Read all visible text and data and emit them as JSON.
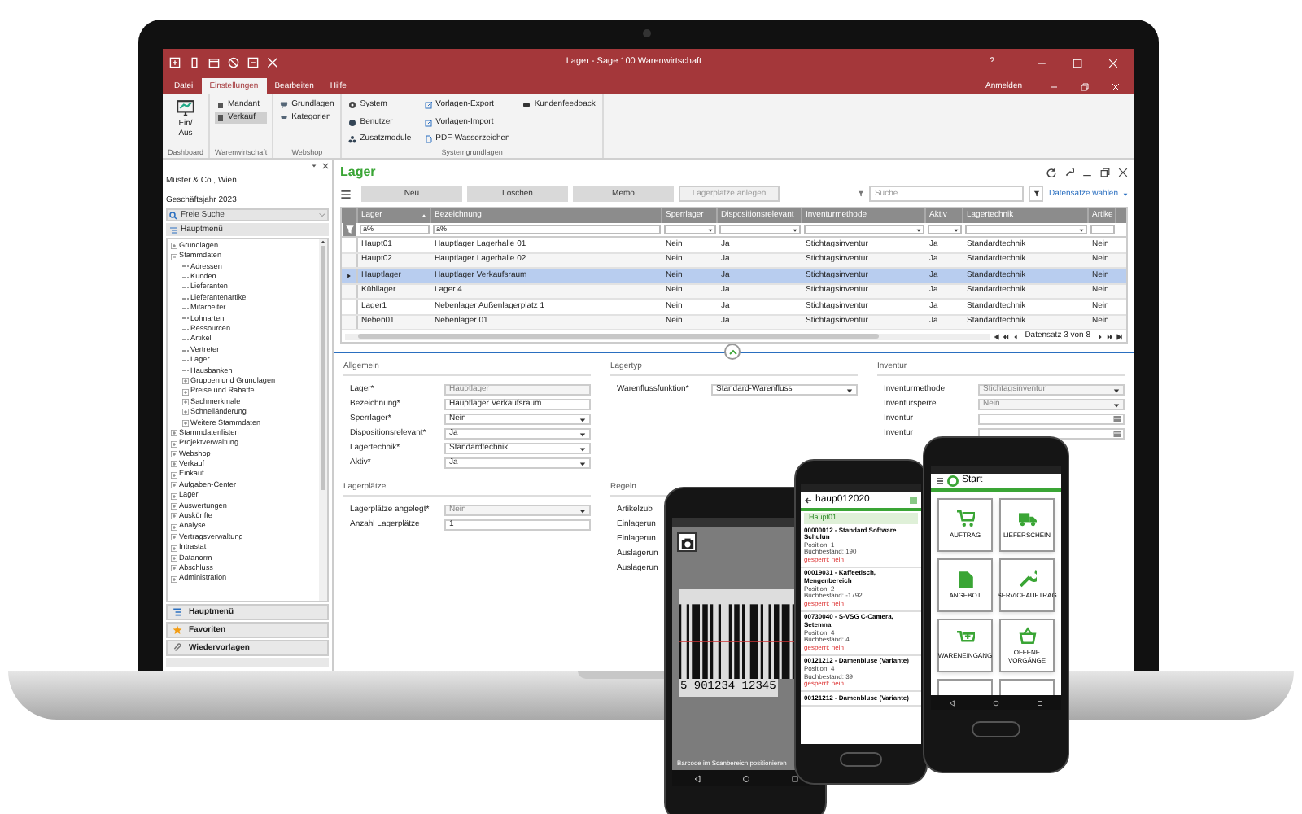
{
  "window": {
    "title": "Lager - Sage 100 Warenwirtschaft",
    "help": "?"
  },
  "menu_tabs": [
    {
      "label": "Datei",
      "selected": false
    },
    {
      "label": "Einstellungen",
      "selected": true
    },
    {
      "label": "Bearbeiten",
      "selected": false
    },
    {
      "label": "Hilfe",
      "selected": false
    }
  ],
  "sign_in": "Anmelden",
  "ribbon_groups": [
    {
      "label": "Dashboard",
      "items": [
        {
          "label": "Ein/ Aus",
          "kind": "large",
          "selected": false
        }
      ]
    },
    {
      "label": "Warenwirtschaft",
      "items": [
        {
          "label": "Mandant",
          "kind": "small",
          "selected": false
        },
        {
          "label": "Verkauf",
          "kind": "small",
          "selected": true
        }
      ]
    },
    {
      "label": "Webshop",
      "items": [
        {
          "label": "Grundlagen",
          "kind": "small",
          "selected": false
        },
        {
          "label": "Kategorien",
          "kind": "small",
          "selected": false
        }
      ]
    },
    {
      "label": "Systemgrundlagen",
      "items": [
        {
          "label": "System",
          "kind": "small",
          "selected": false
        },
        {
          "label": "Benutzer",
          "kind": "small",
          "selected": false
        },
        {
          "label": "Zusatzmodule",
          "kind": "small",
          "selected": false
        },
        {
          "label": "Vorlagen-Export",
          "kind": "small",
          "selected": false
        },
        {
          "label": "Vorlagen-Import",
          "kind": "small",
          "selected": false
        },
        {
          "label": "PDF-Wasserzeichen",
          "kind": "small",
          "selected": false
        },
        {
          "label": "Kundenfeedback",
          "kind": "small",
          "selected": false
        }
      ]
    }
  ],
  "sidebar": {
    "company": "Muster & Co., Wien",
    "fiscal_year": "Geschäftsjahr 2023",
    "search": {
      "placeholder": "Freie Suche"
    },
    "section": "Hauptmenü",
    "tree": [
      {
        "label": "Grundlagen",
        "expanded": false
      },
      {
        "label": "Stammdaten",
        "expanded": true,
        "children": [
          {
            "label": "Adressen"
          },
          {
            "label": "Kunden"
          },
          {
            "label": "Lieferanten"
          },
          {
            "label": "Lieferantenartikel"
          },
          {
            "label": "Mitarbeiter"
          },
          {
            "label": "Lohnarten"
          },
          {
            "label": "Ressourcen"
          },
          {
            "label": "Artikel"
          },
          {
            "label": "Vertreter"
          },
          {
            "label": "Lager"
          },
          {
            "label": "Hausbanken"
          },
          {
            "label": "Gruppen und Grundlagen",
            "expanded": false
          },
          {
            "label": "Preise und Rabatte",
            "expanded": false
          },
          {
            "label": "Sachmerkmale",
            "expanded": false
          },
          {
            "label": "Schnelländerung",
            "expanded": false
          },
          {
            "label": "Weitere Stammdaten",
            "expanded": false
          }
        ]
      },
      {
        "label": "Stammdatenlisten",
        "expanded": false
      },
      {
        "label": "Projektverwaltung",
        "expanded": false
      },
      {
        "label": "Webshop",
        "expanded": false
      },
      {
        "label": "Verkauf",
        "expanded": false
      },
      {
        "label": "Einkauf",
        "expanded": false
      },
      {
        "label": "Aufgaben-Center",
        "expanded": false
      },
      {
        "label": "Lager",
        "expanded": false
      },
      {
        "label": "Auswertungen",
        "expanded": false
      },
      {
        "label": "Auskünfte",
        "expanded": false
      },
      {
        "label": "Analyse",
        "expanded": false
      },
      {
        "label": "Vertragsverwaltung",
        "expanded": false
      },
      {
        "label": "Intrastat",
        "expanded": false
      },
      {
        "label": "Datanorm",
        "expanded": false
      },
      {
        "label": "Abschluss",
        "expanded": false
      },
      {
        "label": "Administration",
        "expanded": false
      }
    ],
    "nav": [
      {
        "label": "Hauptmenü"
      },
      {
        "label": "Favoriten"
      },
      {
        "label": "Wiedervorlagen"
      }
    ]
  },
  "main": {
    "title": "Lager",
    "toolbar": [
      {
        "label": "Neu",
        "disabled": false
      },
      {
        "label": "Löschen",
        "disabled": false
      },
      {
        "label": "Memo",
        "disabled": false
      },
      {
        "label": "Lagerplätze anlegen",
        "disabled": true
      }
    ],
    "search": {
      "placeholder": "Suche"
    },
    "records_link": "Datensätze wählen",
    "table": {
      "columns": [
        {
          "label": "Lager",
          "filter": "a%",
          "kind": "text"
        },
        {
          "label": "Bezeichnung",
          "filter": "a%",
          "kind": "text"
        },
        {
          "label": "Sperrlager",
          "kind": "select"
        },
        {
          "label": "Dispositionsrelevant",
          "kind": "select"
        },
        {
          "label": "Inventurmethode",
          "kind": "select"
        },
        {
          "label": "Aktiv",
          "kind": "select"
        },
        {
          "label": "Lagertechnik",
          "kind": "select"
        },
        {
          "label": "Artike",
          "kind": "text"
        }
      ],
      "rows": [
        {
          "cells": [
            "Haupt01",
            "Hauptlager Lagerhalle 01",
            "Nein",
            "Ja",
            "Stichtagsinventur",
            "Ja",
            "Standardtechnik",
            "Nein"
          ],
          "selected": false
        },
        {
          "cells": [
            "Haupt02",
            "Hauptlager Lagerhalle 02",
            "Nein",
            "Ja",
            "Stichtagsinventur",
            "Ja",
            "Standardtechnik",
            "Nein"
          ],
          "selected": false
        },
        {
          "cells": [
            "Hauptlager",
            "Hauptlager Verkaufsraum",
            "Nein",
            "Ja",
            "Stichtagsinventur",
            "Ja",
            "Standardtechnik",
            "Nein"
          ],
          "selected": true
        },
        {
          "cells": [
            "Kühllager",
            "Lager 4",
            "Nein",
            "Ja",
            "Stichtagsinventur",
            "Ja",
            "Standardtechnik",
            "Nein"
          ],
          "selected": false
        },
        {
          "cells": [
            "Lager1",
            "Nebenlager Außenlagerplatz 1",
            "Nein",
            "Ja",
            "Stichtagsinventur",
            "Ja",
            "Standardtechnik",
            "Nein"
          ],
          "selected": false
        },
        {
          "cells": [
            "Neben01",
            "Nebenlager 01",
            "Nein",
            "Ja",
            "Stichtagsinventur",
            "Ja",
            "Standardtechnik",
            "Nein"
          ],
          "selected": false
        }
      ],
      "pager": "Datensatz 3 von 8"
    },
    "form": [
      {
        "title": "Allgemein",
        "fields": [
          {
            "label": "Lager*",
            "value": "Hauptlager",
            "kind": "text",
            "disabled": true
          },
          {
            "label": "Bezeichnung*",
            "value": "Hauptlager Verkaufsraum",
            "kind": "text",
            "disabled": false
          },
          {
            "label": "Sperrlager*",
            "value": "Nein",
            "kind": "select",
            "disabled": false
          },
          {
            "label": "Dispositionsrelevant*",
            "value": "Ja",
            "kind": "select",
            "disabled": false
          },
          {
            "label": "Lagertechnik*",
            "value": "Standardtechnik",
            "kind": "select",
            "disabled": false
          },
          {
            "label": "Aktiv*",
            "value": "Ja",
            "kind": "select",
            "disabled": false
          }
        ]
      },
      {
        "title": "Lagertyp",
        "fields": [
          {
            "label": "Warenflussfunktion*",
            "value": "Standard-Warenfluss",
            "kind": "select",
            "disabled": false
          }
        ]
      },
      {
        "title": "Inventur",
        "fields": [
          {
            "label": "Inventurmethode",
            "value": "Stichtagsinventur",
            "kind": "select",
            "disabled": true
          },
          {
            "label": "Inventursperre",
            "value": "Nein",
            "kind": "select",
            "disabled": true
          },
          {
            "label": "Inventur",
            "kind": "date",
            "disabled": false
          },
          {
            "label": "Inventur",
            "kind": "date",
            "disabled": false
          }
        ]
      },
      {
        "title": "Lagerplätze",
        "fields": [
          {
            "label": "Lagerplätze angelegt*",
            "value": "Nein",
            "kind": "select",
            "disabled": true
          },
          {
            "label": "Anzahl Lagerplätze",
            "value": "1",
            "kind": "text",
            "disabled": false
          }
        ]
      },
      {
        "title": "Regeln",
        "fields": [
          {
            "label": "Artikelzub",
            "kind": "label"
          },
          {
            "label": "Einlagerun",
            "kind": "label"
          },
          {
            "label": "Einlagerun",
            "kind": "label"
          },
          {
            "label": "Auslagerun",
            "kind": "label"
          },
          {
            "label": "Auslagerun",
            "kind": "label"
          }
        ]
      }
    ]
  },
  "phones": {
    "scanner": {
      "barcode_digits": "5 901234 12345",
      "hint": "Barcode im Scanbereich positionieren"
    },
    "picking": {
      "title": "haup012020",
      "location": "Haupt01",
      "entries": [
        {
          "title": "00000012 - Standard Software Schulun",
          "lines": [
            "Position: 1",
            "Buchbestand: 190",
            "gesperrt: nein"
          ]
        },
        {
          "title": "00019031 - Kaffeetisch, Mengenbereich",
          "lines": [
            "Position: 2",
            "Buchbestand: -1792",
            "gesperrt: nein"
          ]
        },
        {
          "title": "00730040 - S-VSG C-Camera, Setemna",
          "lines": [
            "Position: 4",
            "Buchbestand: 4",
            "gesperrt: nein"
          ]
        },
        {
          "title": "00121212 - Damenbluse (Variante)",
          "lines": [
            "Position: 4",
            "Buchbestand: 39",
            "gesperrt: nein"
          ]
        },
        {
          "title": "00121212 - Damenbluse (Variante)"
        }
      ]
    },
    "home": {
      "title": "Start",
      "tiles": [
        {
          "label": "AUFTRAG"
        },
        {
          "label": "LIEFERSCHEIN"
        },
        {
          "label": "ANGEBOT"
        },
        {
          "label": "SERVICEAUFTRAG"
        },
        {
          "label": "WARENEINGANG"
        },
        {
          "label": "OFFENE VORGÄNGE"
        }
      ]
    }
  }
}
